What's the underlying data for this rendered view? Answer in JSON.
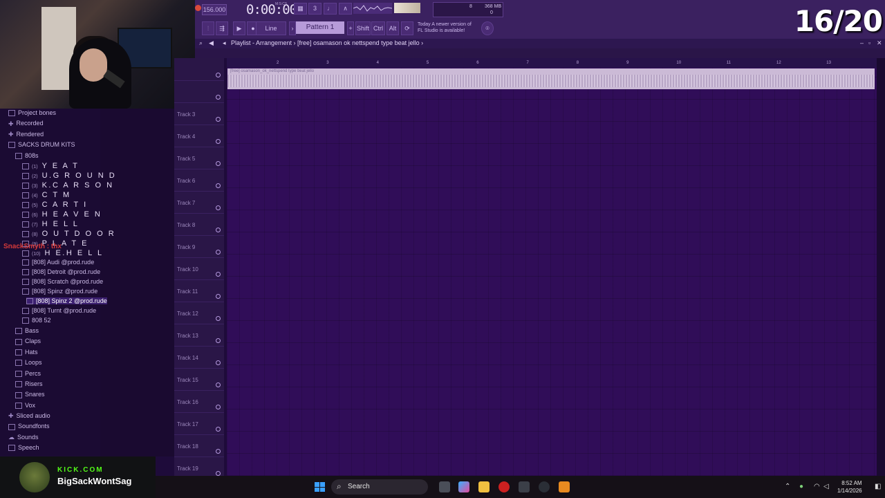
{
  "toolbar": {
    "tempo": "156.000",
    "time": "0:00:00",
    "time_unit": "M:S:CS",
    "cpu_num": "8",
    "memory": "368 MB",
    "cpu_zero": "0",
    "line_label": "Line",
    "pattern": "Pattern 1",
    "shift": "Shift",
    "ctrl": "Ctrl",
    "alt": "Alt",
    "notice_day": "Today",
    "notice_line1": "A newer version of",
    "notice_line2": "FL Studio is available!"
  },
  "counter": "16/20",
  "playlist": {
    "title": "Playlist - Arrangement",
    "project": "[free] osamason ok nettspend type beat jello",
    "clip_name": "[free] osamason_ok_nettspend type beat jello"
  },
  "browser": {
    "items": [
      {
        "label": "Project bones",
        "icon": "folder"
      },
      {
        "label": "Recorded",
        "icon": "plus"
      },
      {
        "label": "Rendered",
        "icon": "plus"
      },
      {
        "label": "SACKS DRUM KITS",
        "icon": "folder"
      },
      {
        "label": "808s",
        "icon": "folder"
      }
    ],
    "kits": [
      {
        "num": "(1)",
        "label": "Y E A T"
      },
      {
        "num": "(2)",
        "label": "U.G R O U N D"
      },
      {
        "num": "(3)",
        "label": "K.C A R S O N"
      },
      {
        "num": "(4)",
        "label": "C T M"
      },
      {
        "num": "(5)",
        "label": "C A R T I"
      },
      {
        "num": "(6)",
        "label": "H E A V E N"
      },
      {
        "num": "(7)",
        "label": "H E L L"
      },
      {
        "num": "(8)",
        "label": "O U T D O O R"
      },
      {
        "num": "(9)",
        "label": "P L A T E"
      },
      {
        "num": "(10)",
        "label": "H E.H E L L"
      }
    ],
    "files": [
      "[808] Audi @prod.rude",
      "[808] Detroit @prod.rude",
      "[808] Scratch @prod.rude",
      "[808] Spinz @prod.rude",
      "[808] Spinz 2 @prod.rude",
      "[808] Turnt @prod.rude",
      "808 52"
    ],
    "folders": [
      "Bass",
      "Claps",
      "Hats",
      "Loops",
      "Percs",
      "Risers",
      "Snares",
      "Vox"
    ],
    "bottom": [
      {
        "label": "Sliced audio",
        "icon": "plus"
      },
      {
        "label": "Soundfonts",
        "icon": "folder"
      },
      {
        "label": "Sounds",
        "icon": "cloud"
      },
      {
        "label": "Speech",
        "icon": "folder"
      }
    ],
    "overlay_text": "SnackSmyth : thx"
  },
  "tracks": [
    "Track 3",
    "Track 4",
    "Track 5",
    "Track 6",
    "Track 7",
    "Track 8",
    "Track 9",
    "Track 10",
    "Track 11",
    "Track 12",
    "Track 13",
    "Track 14",
    "Track 15",
    "Track 16",
    "Track 17",
    "Track 18",
    "Track 19"
  ],
  "ruler": [
    "2",
    "3",
    "4",
    "5",
    "6",
    "7",
    "8",
    "9",
    "10",
    "11",
    "12",
    "13"
  ],
  "badge": {
    "platform": "KICK.COM",
    "name": "BigSackWontSag"
  },
  "taskbar": {
    "search": "Search",
    "time": "8:52 AM",
    "date": "1/14/2026"
  },
  "colors": {
    "playlist_bg": "#300d58",
    "toolbar": "#3b2160",
    "clip": "#cbbad6",
    "kick_green": "#53fc18"
  }
}
